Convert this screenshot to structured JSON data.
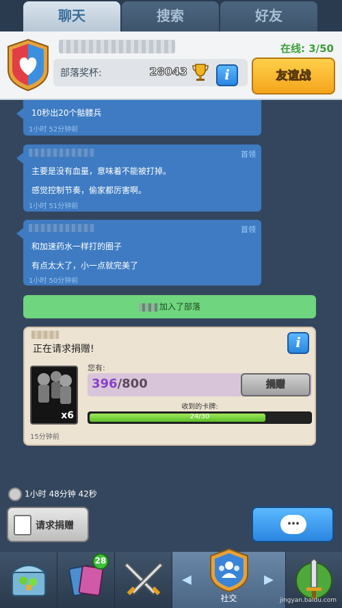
{
  "tabs": [
    {
      "label": "聊天"
    },
    {
      "label": "搜索"
    },
    {
      "label": "好友"
    }
  ],
  "clan": {
    "trophy_label": "部落奖杯:",
    "trophies": "28043",
    "online": "在线: 3/50",
    "friendly_battle": "友谊战"
  },
  "messages": [
    {
      "lines": [
        "10秒出20个骷髅兵"
      ],
      "time": "1小时 52分钟前",
      "role": ""
    },
    {
      "lines": [
        "主要是没有血量，意味着不能被打掉。",
        "感觉控制节奏，偷家都厉害啊。"
      ],
      "time": "1小时 51分钟前",
      "role": "首领"
    },
    {
      "lines": [
        "和加速药水一样打的圈子",
        "有点太大了，小一点就完美了"
      ],
      "time": "1小时 50分钟前",
      "role": "首领"
    }
  ],
  "system_message": "加入了部落",
  "donation": {
    "title": "正在请求捐赠!",
    "you_have": "您有:",
    "count": "396",
    "max": "/800",
    "donate_button": "捐赠",
    "received_label": "收到的卡牌:",
    "received": "24/30",
    "received_fraction": 0.8,
    "card_count": "x6",
    "time": "15分钟前"
  },
  "request_timer": "1小时 48分钟  42秒",
  "request_button": "请求捐赠",
  "chat_button_icon": "chat-bubble-icon",
  "nav": {
    "badge": "28",
    "social_label": "社交"
  },
  "watermark": "jingyan.baidu.com"
}
